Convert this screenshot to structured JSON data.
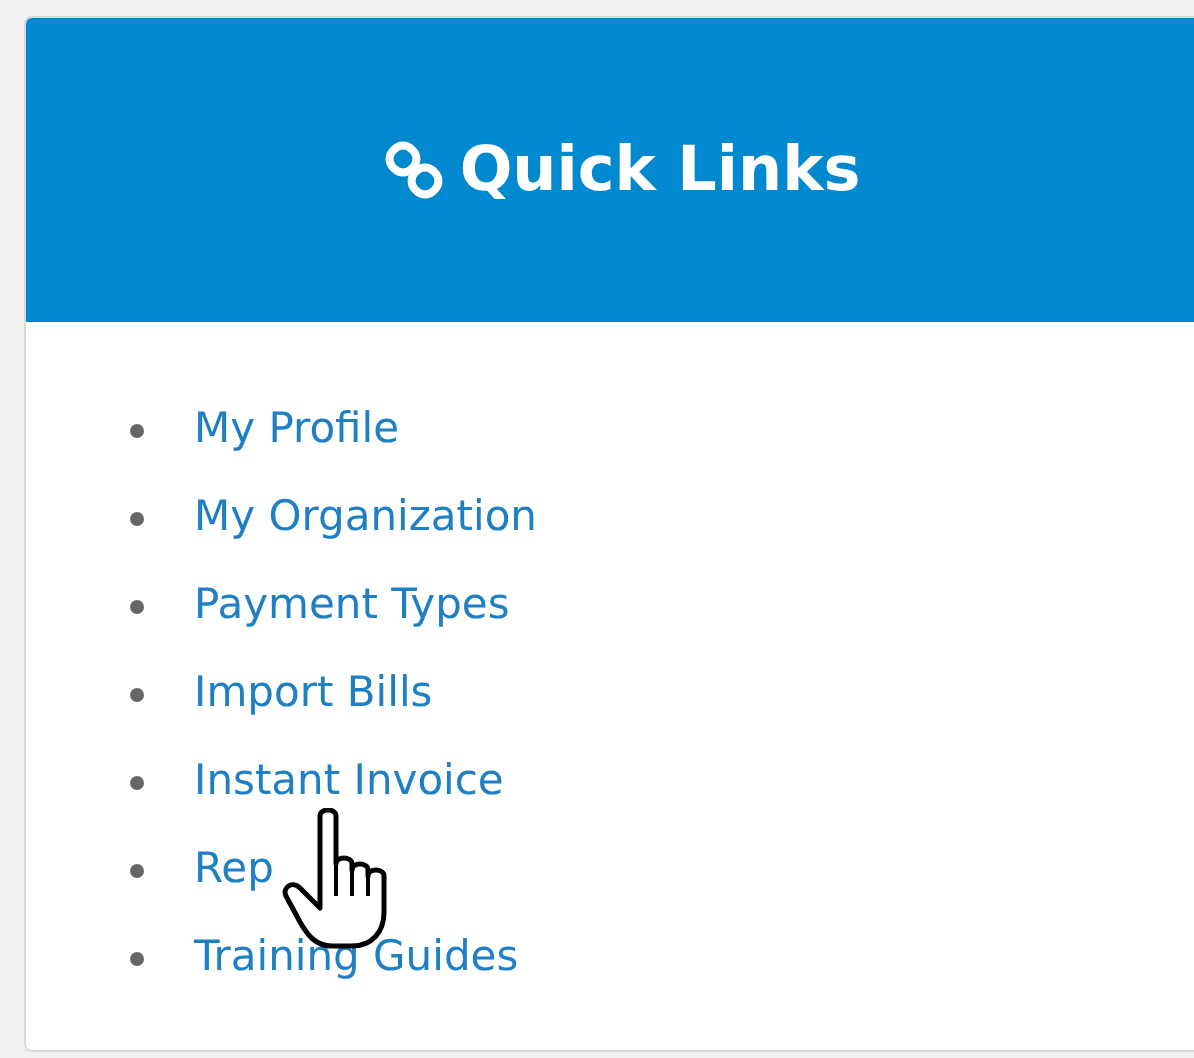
{
  "panel": {
    "title": "Quick Links"
  },
  "links": [
    "My Profile",
    "My Organization",
    "Payment Types",
    "Import Bills",
    "Instant Invoice",
    "Rep",
    "Training Guides"
  ]
}
